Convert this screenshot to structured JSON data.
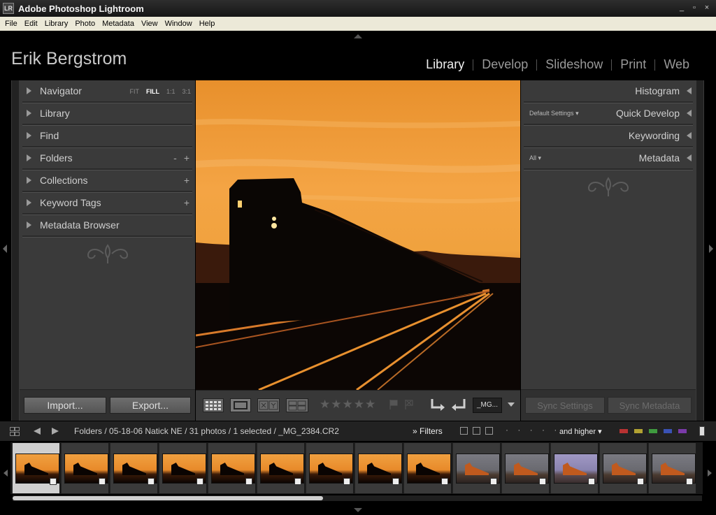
{
  "window": {
    "title": "Adobe Photoshop Lightroom",
    "icon": "LR",
    "controls": [
      "_",
      "▫",
      "×"
    ]
  },
  "menu": [
    "File",
    "Edit",
    "Library",
    "Photo",
    "Metadata",
    "View",
    "Window",
    "Help"
  ],
  "identity_plate": "Erik Bergstrom",
  "modules": [
    {
      "label": "Library",
      "active": true
    },
    {
      "label": "Develop",
      "active": false
    },
    {
      "label": "Slideshow",
      "active": false
    },
    {
      "label": "Print",
      "active": false
    },
    {
      "label": "Web",
      "active": false
    }
  ],
  "left_panel": {
    "navigator": {
      "label": "Navigator",
      "zoom": [
        "FIT",
        "FILL",
        "1:1",
        "3:1"
      ],
      "selected_zoom": "FILL"
    },
    "library": {
      "label": "Library"
    },
    "find": {
      "label": "Find"
    },
    "folders": {
      "label": "Folders",
      "minus": "-",
      "plus": "+"
    },
    "collections": {
      "label": "Collections",
      "plus": "+"
    },
    "keyword_tags": {
      "label": "Keyword Tags",
      "plus": "+"
    },
    "metadata_browser": {
      "label": "Metadata Browser"
    },
    "import_label": "Import...",
    "export_label": "Export..."
  },
  "right_panel": {
    "histogram": {
      "label": "Histogram"
    },
    "quick_develop": {
      "label": "Quick Develop",
      "preset": "Default Settings"
    },
    "keywording": {
      "label": "Keywording"
    },
    "metadata": {
      "label": "Metadata",
      "preset": "All"
    },
    "sync_settings_label": "Sync Settings",
    "sync_metadata_label": "Sync Metadata"
  },
  "toolbar": {
    "filename": "_MG...",
    "stars": "★★★★★"
  },
  "filmstrip_bar": {
    "breadcrumb": "Folders / 05-18-06 Natick NE / 31 photos / 1 selected / _MG_2384.CR2",
    "filters_label": "Filters",
    "filters_prefix": "»",
    "dots": "· · · · ·",
    "rating_filter": "and higher",
    "colors": {
      "red": "#b83232",
      "yellow": "#b2a232",
      "green": "#3f9a3f",
      "blue": "#3a52b4",
      "purple": "#7a3aa8"
    }
  },
  "filmstrip": {
    "selected_index": 0,
    "scroll_fraction": 0.45,
    "thumbnails": [
      "sunset",
      "sunset",
      "sunset",
      "sunset",
      "sunset",
      "sunset",
      "sunset",
      "sunset",
      "sunset",
      "day-grey",
      "day-grey",
      "day-purple",
      "day-grey",
      "day-grey"
    ]
  }
}
